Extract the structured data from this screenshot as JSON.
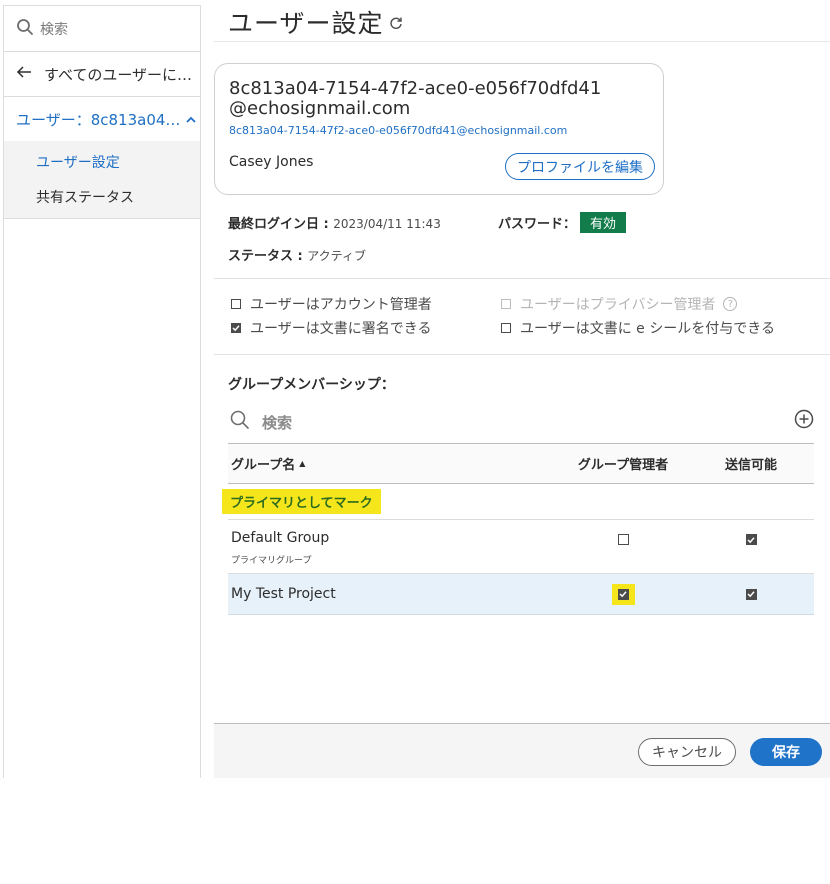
{
  "sidebar": {
    "search_placeholder": "検索",
    "back_label": "すべてのユーザーに…",
    "user_label": "ユーザー：8c813a04…",
    "items": [
      {
        "label": "ユーザー設定",
        "active": true
      },
      {
        "label": "共有ステータス",
        "active": false
      }
    ]
  },
  "header": {
    "title": "ユーザー設定"
  },
  "profile": {
    "user_id": "8c813a04-7154-47f2-ace0-e056f70dfd41",
    "domain": "@echosignmail.com",
    "email": "8c813a04-7154-47f2-ace0-e056f70dfd41@echosignmail.com",
    "name": "Casey Jones",
    "edit_label": "プロファイルを編集"
  },
  "info": {
    "last_login_label": "最終ログイン日 : ",
    "last_login_value": "2023/04/11 11:43",
    "password_label": "パスワード：",
    "password_status": "有効",
    "status_label": "ステータス : ",
    "status_value": "アクティブ"
  },
  "permissions": {
    "account_admin": {
      "label": "ユーザーはアカウント管理者",
      "checked": false
    },
    "privacy_admin": {
      "label": "ユーザーはプライバシー管理者",
      "checked": false,
      "disabled": true
    },
    "can_sign": {
      "label": "ユーザーは文書に署名できる",
      "checked": true
    },
    "can_eseal": {
      "label": "ユーザーは文書に e シールを付与できる",
      "checked": false
    }
  },
  "groups": {
    "section_title": "グループメンバーシップ：",
    "search_placeholder": "検索",
    "columns": {
      "name": "グループ名",
      "admin": "グループ管理者",
      "send": "送信可能"
    },
    "mark_primary": "プライマリとしてマーク",
    "rows": [
      {
        "name": "Default Group",
        "sub": "プライマリグループ",
        "admin": false,
        "send": true
      },
      {
        "name": "My Test Project",
        "sub": "",
        "admin": true,
        "send": true
      }
    ]
  },
  "footer": {
    "cancel_label": "キャンセル",
    "save_label": "保存"
  },
  "colors": {
    "accent": "#1f73c9",
    "active_badge": "#127c4b",
    "highlight": "#f5e61c",
    "selected_row": "#e7f1fa"
  }
}
